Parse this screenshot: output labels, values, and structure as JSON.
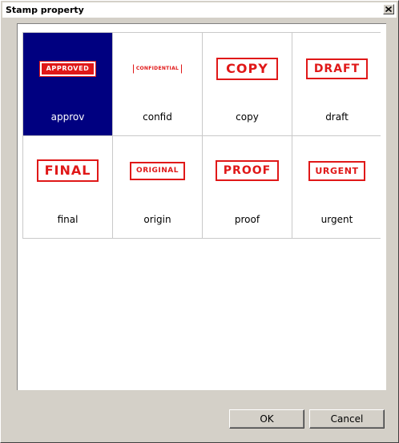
{
  "window": {
    "title": "Stamp property",
    "close_label": "x"
  },
  "stamps": [
    {
      "name": "approv",
      "stamp_text": "APPROVED",
      "selected": true
    },
    {
      "name": "confid",
      "stamp_text": "CONFIDENTIAL"
    },
    {
      "name": "copy",
      "stamp_text": "COPY"
    },
    {
      "name": "draft",
      "stamp_text": "DRAFT"
    },
    {
      "name": "final",
      "stamp_text": "FINAL"
    },
    {
      "name": "origin",
      "stamp_text": "ORIGINAL"
    },
    {
      "name": "proof",
      "stamp_text": "PROOF"
    },
    {
      "name": "urgent",
      "stamp_text": "URGENT"
    }
  ],
  "buttons": {
    "ok_label": "OK",
    "cancel_label": "Cancel"
  },
  "colors": {
    "selection": "#000080",
    "stamp_red": "#e01818",
    "dialog_gray": "#d4d0c8"
  }
}
